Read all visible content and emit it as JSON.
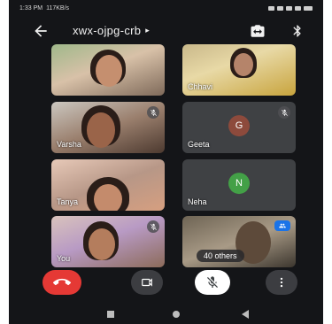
{
  "status_bar": {
    "time": "1:33 PM",
    "network_speed": "117KB/s"
  },
  "header": {
    "meeting_code": "xwx-ojpg-crb",
    "caret": "▸"
  },
  "tiles": [
    {
      "name": "",
      "muted": false
    },
    {
      "name": "Chhavi",
      "muted": false
    },
    {
      "name": "Varsha",
      "muted": true
    },
    {
      "name": "Geeta",
      "avatar_letter": "G",
      "avatar_color": "#8d4a3c",
      "muted": true
    },
    {
      "name": "Tanya",
      "muted": false
    },
    {
      "name": "Neha",
      "avatar_letter": "N",
      "avatar_color": "#43a047",
      "muted": false
    },
    {
      "name": "You",
      "muted": true
    },
    {
      "name": "40 others",
      "muted": false
    }
  ],
  "colors": {
    "end_call": "#e53935",
    "background": "#141518",
    "accent_blue": "#1a73e8"
  },
  "icons": {
    "back": "arrow-left-icon",
    "switch_camera": "switch-camera-icon",
    "bluetooth": "bluetooth-icon",
    "end_call": "phone-hangup-icon",
    "video": "video-camera-icon",
    "mic": "mic-off-icon",
    "more": "more-vertical-icon"
  }
}
